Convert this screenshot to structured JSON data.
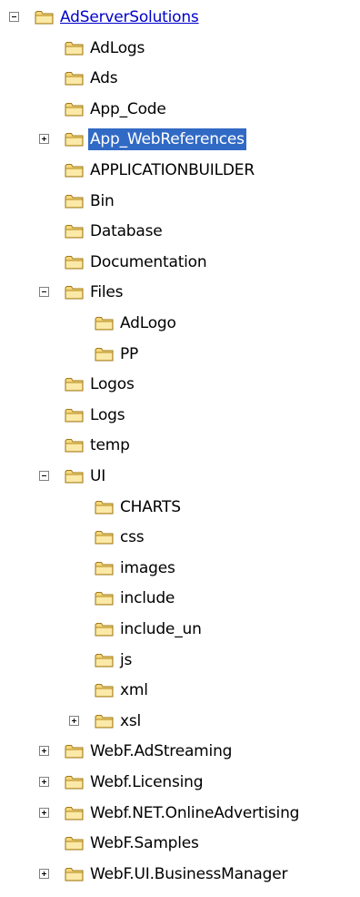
{
  "tree": {
    "nodes": [
      {
        "label": "AdServerSolutions",
        "level": 0,
        "toggle": "minus",
        "link": true
      },
      {
        "label": "AdLogs",
        "level": 1
      },
      {
        "label": "Ads",
        "level": 1
      },
      {
        "label": "App_Code",
        "level": 1
      },
      {
        "label": "App_WebReferences",
        "level": 1,
        "toggle": "plus",
        "selected": true
      },
      {
        "label": "APPLICATIONBUILDER",
        "level": 1
      },
      {
        "label": "Bin",
        "level": 1
      },
      {
        "label": "Database",
        "level": 1
      },
      {
        "label": "Documentation",
        "level": 1
      },
      {
        "label": "Files",
        "level": 1,
        "toggle": "minus"
      },
      {
        "label": "AdLogo",
        "level": 2
      },
      {
        "label": "PP",
        "level": 2
      },
      {
        "label": "Logos",
        "level": 1
      },
      {
        "label": "Logs",
        "level": 1
      },
      {
        "label": "temp",
        "level": 1
      },
      {
        "label": "UI",
        "level": 1,
        "toggle": "minus"
      },
      {
        "label": "CHARTS",
        "level": 2
      },
      {
        "label": "css",
        "level": 2
      },
      {
        "label": "images",
        "level": 2
      },
      {
        "label": "include",
        "level": 2
      },
      {
        "label": "include_un",
        "level": 2
      },
      {
        "label": "js",
        "level": 2
      },
      {
        "label": "xml",
        "level": 2
      },
      {
        "label": "xsl",
        "level": 2,
        "toggle": "plus"
      },
      {
        "label": "WebF.AdStreaming",
        "level": 1,
        "toggle": "plus"
      },
      {
        "label": "Webf.Licensing",
        "level": 1,
        "toggle": "plus"
      },
      {
        "label": "Webf.NET.OnlineAdvertising",
        "level": 1,
        "toggle": "plus"
      },
      {
        "label": "WebF.Samples",
        "level": 1
      },
      {
        "label": "WebF.UI.BusinessManager",
        "level": 1,
        "toggle": "plus"
      }
    ]
  },
  "icons": {
    "folder": "folder-icon",
    "expand": "expand-plus-icon",
    "collapse": "collapse-minus-icon"
  },
  "colors": {
    "selection_bg": "#316ac5",
    "selection_text": "#ffffff",
    "link": "#0000cc",
    "folder_fill": "#f5d77a",
    "folder_stroke": "#a07a1a"
  }
}
